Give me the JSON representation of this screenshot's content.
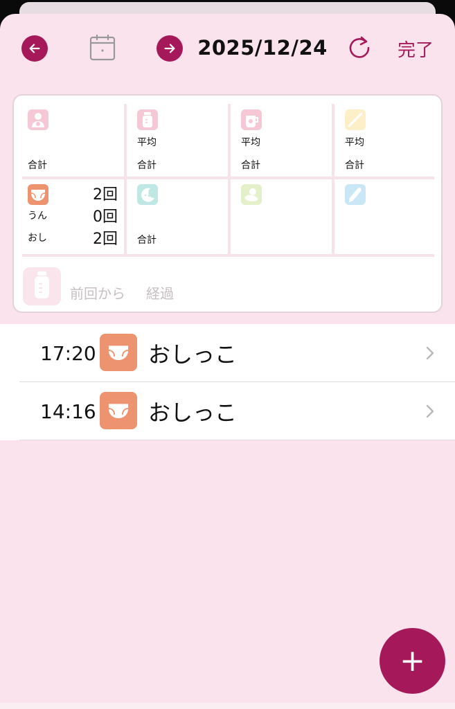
{
  "header": {
    "date": "2025/12/24",
    "done_label": "完了",
    "prev_icon": "arrow-left-icon",
    "next_icon": "arrow-right-icon",
    "calendar_icon": "calendar-icon",
    "refresh_icon": "refresh-icon"
  },
  "summary": {
    "nursing": {
      "icon": "nursing-icon",
      "total_label": "合計"
    },
    "milk": {
      "icon": "bottle-icon",
      "avg_label": "平均",
      "total_label": "合計"
    },
    "pump": {
      "icon": "pump-cup-icon",
      "avg_label": "平均",
      "total_label": "合計"
    },
    "baby_food": {
      "icon": "food-icon",
      "avg_label": "平均",
      "total_label": "合計"
    },
    "diaper": {
      "icon": "diaper-icon",
      "total_value": "2回",
      "poo_label": "うん",
      "poo_value": "0回",
      "pee_label": "おし",
      "pee_value": "2回"
    },
    "sleep": {
      "icon": "sleep-moon-icon",
      "total_label": "合計"
    },
    "bath": {
      "icon": "bath-icon"
    },
    "temperature": {
      "icon": "thermometer-icon"
    },
    "last": {
      "icon": "bottle-icon",
      "since_label": "前回から",
      "elapsed_label": "経過"
    }
  },
  "entries": [
    {
      "time": "17:20",
      "label": "おしっこ",
      "icon": "diaper-icon"
    },
    {
      "time": "14:16",
      "label": "おしっこ",
      "icon": "diaper-icon"
    }
  ],
  "fab": {
    "label": "+",
    "icon": "plus-icon"
  },
  "colors": {
    "accent": "#a5195a",
    "background": "#fae3ec",
    "diaper": "#ed936f",
    "nursing": "#f6c8d6",
    "sleep": "#bfe8e4",
    "bath": "#e4f0c9",
    "temperature": "#c9e7f7",
    "food": "#fdf0c9"
  }
}
